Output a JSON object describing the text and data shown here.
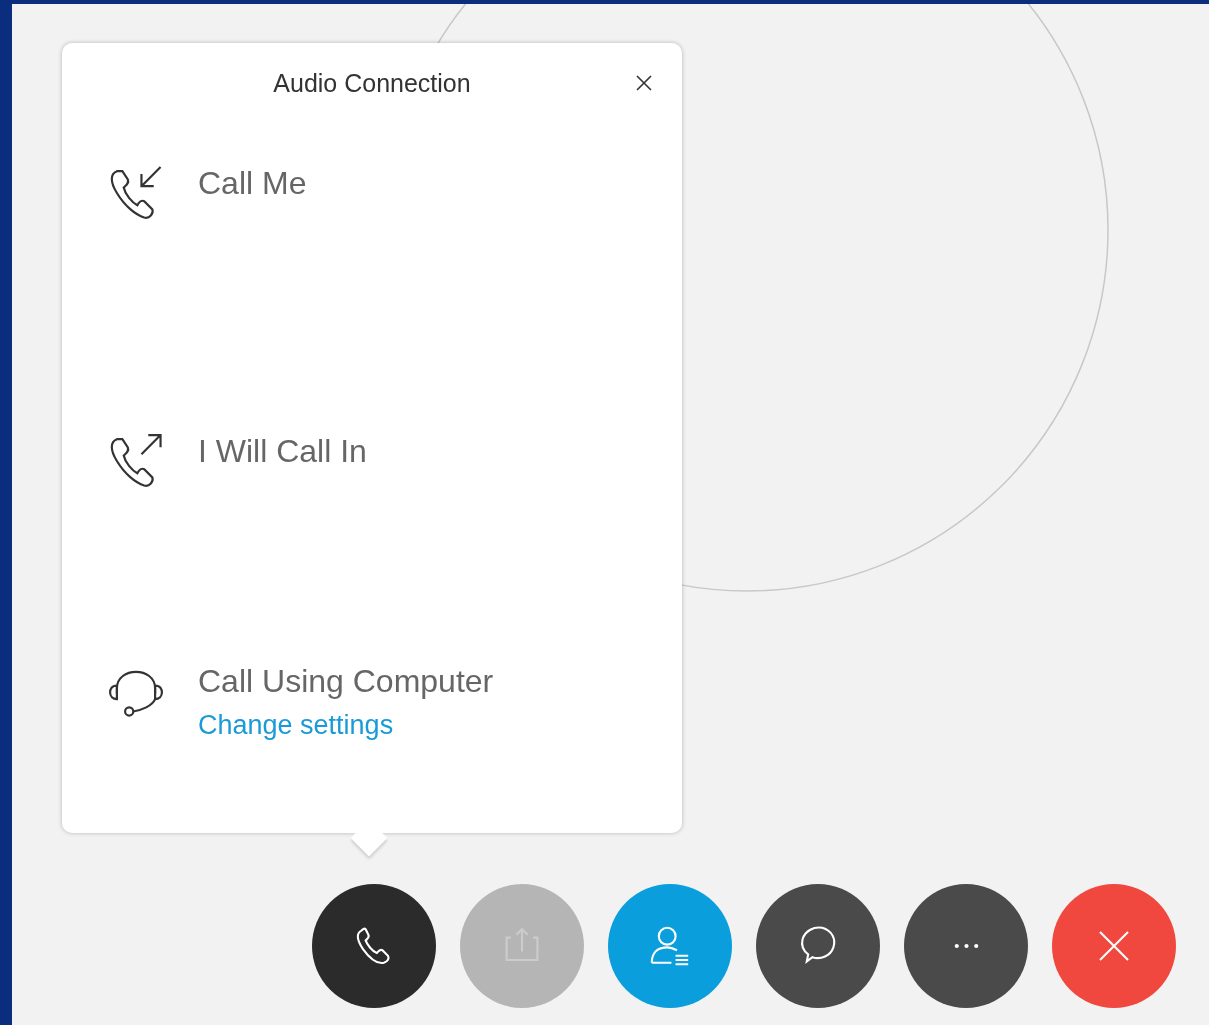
{
  "popup": {
    "title": "Audio Connection",
    "options": [
      {
        "kind": "call-me",
        "label": "Call Me"
      },
      {
        "kind": "call-in",
        "label": "I Will Call In"
      },
      {
        "kind": "computer",
        "label": "Call Using Computer",
        "link": "Change settings"
      }
    ]
  },
  "toolbar": [
    {
      "kind": "audio",
      "active": true,
      "disabled": false
    },
    {
      "kind": "share",
      "disabled": true
    },
    {
      "kind": "participants",
      "active": true,
      "disabled": false
    },
    {
      "kind": "chat",
      "active": false,
      "disabled": false
    },
    {
      "kind": "more",
      "active": false,
      "disabled": false
    },
    {
      "kind": "end"
    }
  ]
}
